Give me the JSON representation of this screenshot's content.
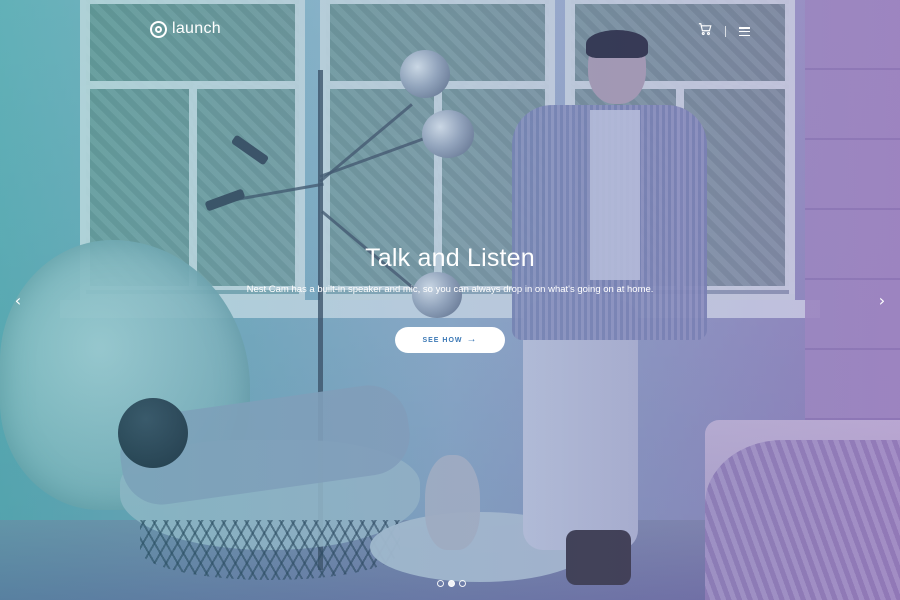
{
  "header": {
    "logo_text": "launch",
    "logo_icon": "launch-logo-icon",
    "cart_icon": "cart-icon",
    "menu_icon": "menu-icon"
  },
  "hero": {
    "title": "Talk and Listen",
    "subtitle": "Nest Cam has a built-in speaker and mic, so you can always drop in on what's going on at home.",
    "cta_label": "SEE HOW",
    "cta_icon": "arrow-right-icon"
  },
  "carousel": {
    "prev_icon": "chevron-left-icon",
    "next_icon": "chevron-right-icon",
    "prev_glyph": "‹",
    "next_glyph": "›",
    "slide_count": 3,
    "active_slide": 2
  },
  "colors": {
    "overlay_left": "#2a9aa0",
    "overlay_right": "#7a5ab0",
    "button_text": "#3b78b5",
    "foreground": "#ffffff"
  }
}
